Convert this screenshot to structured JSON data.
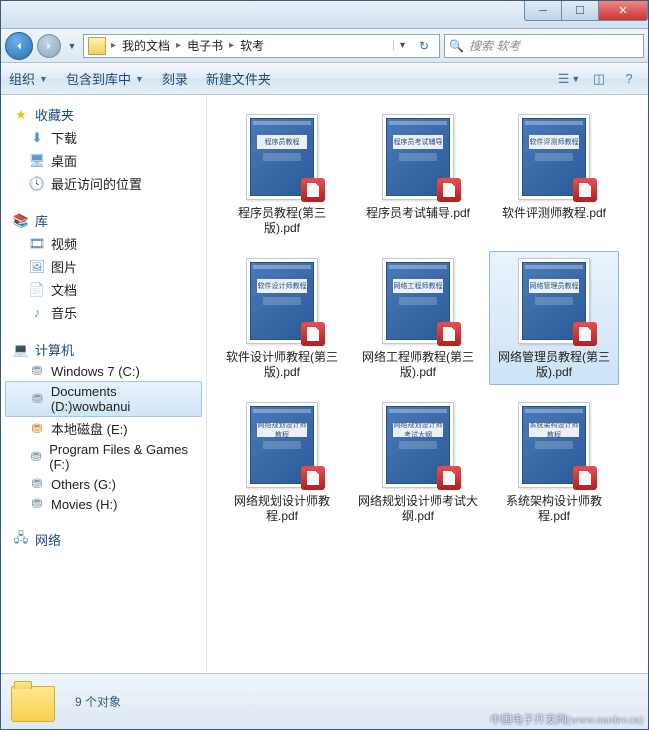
{
  "titlebar": {
    "min": "─",
    "max": "☐",
    "close": "✕"
  },
  "nav": {
    "breadcrumbs": [
      "我的文档",
      "电子书",
      "软考"
    ],
    "search_placeholder": "搜索 软考"
  },
  "toolbar": {
    "organize": "组织",
    "include": "包含到库中",
    "burn": "刻录",
    "newfolder": "新建文件夹"
  },
  "sidebar": {
    "favorites": {
      "label": "收藏夹",
      "items": [
        "下载",
        "桌面",
        "最近访问的位置"
      ]
    },
    "libraries": {
      "label": "库",
      "items": [
        "视频",
        "图片",
        "文档",
        "音乐"
      ]
    },
    "computer": {
      "label": "计算机",
      "items": [
        "Windows 7 (C:)",
        "Documents (D:)wowbanui",
        "本地磁盘 (E:)",
        "Program Files & Games (F:)",
        "Others (G:)",
        "Movies (H:)"
      ]
    },
    "network": {
      "label": "网络"
    }
  },
  "files": [
    {
      "name": "程序员教程(第三版).pdf",
      "cover": "程序员教程"
    },
    {
      "name": "程序员考试辅导.pdf",
      "cover": "程序员考试辅导"
    },
    {
      "name": "软件评测师教程.pdf",
      "cover": "软件评测师教程"
    },
    {
      "name": "软件设计师教程(第三版).pdf",
      "cover": "软件设计师教程"
    },
    {
      "name": "网络工程师教程(第三版).pdf",
      "cover": "网络工程师教程"
    },
    {
      "name": "网络管理员教程(第三版).pdf",
      "cover": "网络管理员教程",
      "selected": true
    },
    {
      "name": "网络规划设计师教程.pdf",
      "cover": "网络规划设计师教程"
    },
    {
      "name": "网络规划设计师考试大纲.pdf",
      "cover": "网络规划设计师考试大纲"
    },
    {
      "name": "系统架构设计师教程.pdf",
      "cover": "系统架构设计师教程"
    }
  ],
  "status": {
    "count": "9 个对象"
  },
  "watermark": "中国电子开发网(www.ourdev.cn)"
}
